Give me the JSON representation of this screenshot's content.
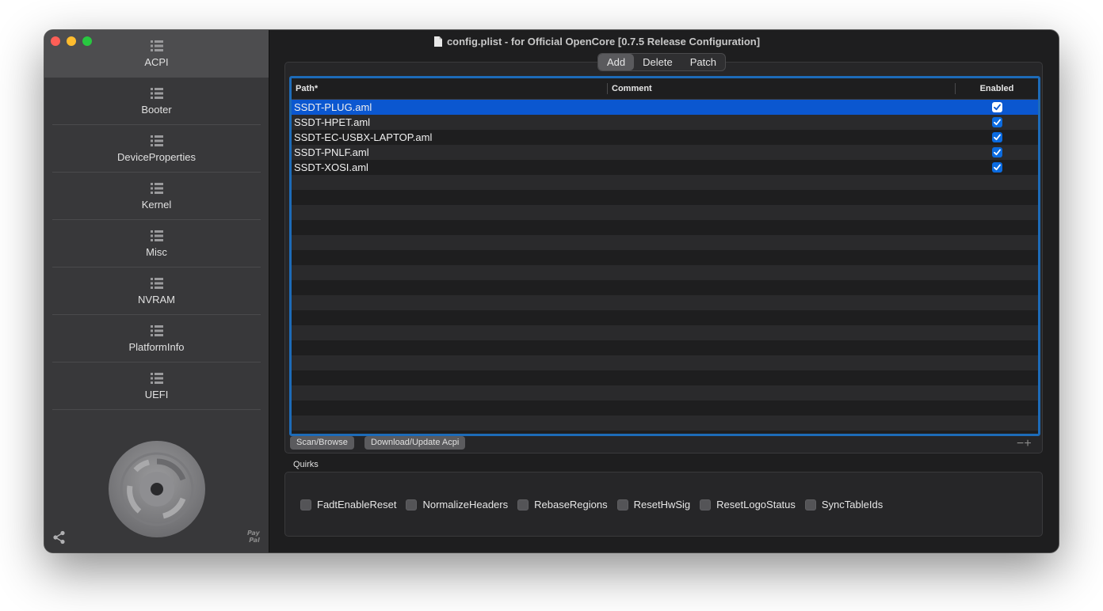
{
  "window": {
    "title": "config.plist - for Official OpenCore [0.7.5 Release Configuration]"
  },
  "sidebar": {
    "items": [
      {
        "label": "ACPI",
        "icon": "list-icon",
        "active": true
      },
      {
        "label": "Booter",
        "icon": "list-icon"
      },
      {
        "label": "DeviceProperties",
        "icon": "list-icon"
      },
      {
        "label": "Kernel",
        "icon": "list-icon"
      },
      {
        "label": "Misc",
        "icon": "list-icon"
      },
      {
        "label": "NVRAM",
        "icon": "list-icon"
      },
      {
        "label": "PlatformInfo",
        "icon": "list-icon"
      },
      {
        "label": "UEFI",
        "icon": "list-icon"
      }
    ],
    "paypal_text": "Pay\nPal"
  },
  "tabs": {
    "items": [
      "Add",
      "Delete",
      "Patch"
    ],
    "selected": "Add"
  },
  "table": {
    "headers": {
      "path": "Path*",
      "comment": "Comment",
      "enabled": "Enabled"
    },
    "rows": [
      {
        "path": "SSDT-PLUG.aml",
        "comment": "",
        "enabled": true,
        "selected": true
      },
      {
        "path": "SSDT-HPET.aml",
        "comment": "",
        "enabled": true
      },
      {
        "path": "SSDT-EC-USBX-LAPTOP.aml",
        "comment": "",
        "enabled": true
      },
      {
        "path": "SSDT-PNLF.aml",
        "comment": "",
        "enabled": true
      },
      {
        "path": "SSDT-XOSI.aml",
        "comment": "",
        "enabled": true
      }
    ],
    "empty_rows": 17
  },
  "buttons": {
    "scan_browse": "Scan/Browse",
    "download_update": "Download/Update Acpi",
    "minus_plus": "−+"
  },
  "quirks": {
    "label": "Quirks",
    "items": [
      {
        "label": "FadtEnableReset",
        "checked": false
      },
      {
        "label": "NormalizeHeaders",
        "checked": false
      },
      {
        "label": "RebaseRegions",
        "checked": false
      },
      {
        "label": "ResetHwSig",
        "checked": false
      },
      {
        "label": "ResetLogoStatus",
        "checked": false
      },
      {
        "label": "SyncTableIds",
        "checked": false
      }
    ]
  },
  "colors": {
    "accent": "#0b57d0",
    "table_border": "#1d6bb8",
    "sidebar_bg": "#38383a",
    "main_bg": "#1e1e1f"
  }
}
